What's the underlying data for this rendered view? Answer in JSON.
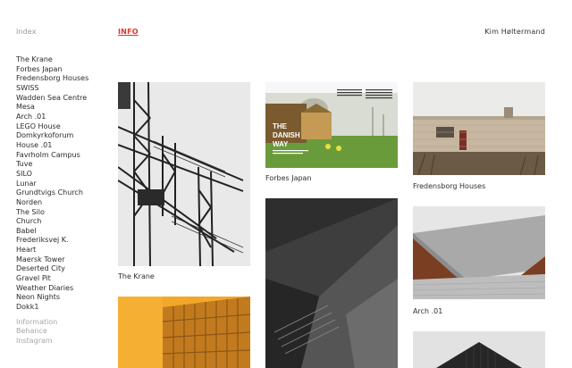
{
  "header": {
    "index_label": "Index",
    "info_label": "INFO",
    "author": "Kim Høltermand"
  },
  "sidebar": {
    "projects": [
      "The Krane",
      "Forbes Japan",
      "Fredensborg Houses",
      "SWISS",
      "Wadden Sea Centre",
      "Mesa",
      "Arch .01",
      "LEGO House",
      "Domkyrkoforum",
      "House .01",
      "Favrholm Campus",
      "Tuve",
      "SILO",
      "Lunar",
      "Grundtvigs Church",
      "Norden",
      "The Silo",
      "Church",
      "Babel",
      "Frederiksvej K.",
      "Heart",
      "Maersk Tower",
      "Deserted City",
      "Gravel Pit",
      "Weather Diaries",
      "Neon Nights",
      "Dokk1"
    ],
    "links": [
      "Information",
      "Behance",
      "Instagram"
    ]
  },
  "gallery": {
    "captions": {
      "krane": "The Krane",
      "forbes": "Forbes Japan",
      "fredensborg": "Fredensborg Houses",
      "arch": "Arch .01"
    },
    "magazine_text": {
      "title_line1": "THE",
      "title_line2": "DANISH",
      "title_line3": "WAY"
    }
  },
  "colors": {
    "accent": "#e0342a",
    "muted": "#a8a8a8"
  }
}
